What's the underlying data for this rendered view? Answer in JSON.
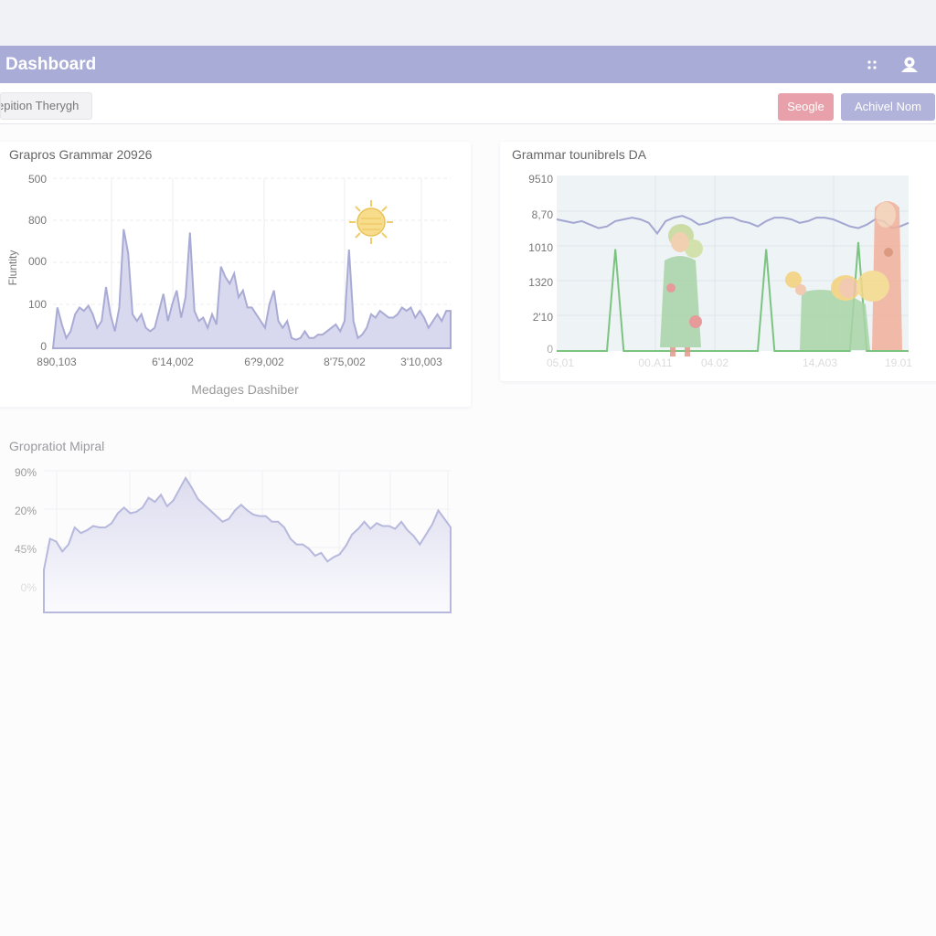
{
  "app": {
    "title": "Dashboard"
  },
  "icons": {
    "menu": "grid-icon",
    "account": "user-icon"
  },
  "colors": {
    "header": "#a9acd6",
    "accent_red": "#e8a1aa",
    "accent_purple": "#b1b3da",
    "chart_fill": "#d6d7ec",
    "chart_line": "#a9abd4",
    "chart_green": "#7bc47f"
  },
  "toolbar": {
    "filter_label": "epition Therygh",
    "google_label": "Seogle",
    "archive_label": "Achivel Nom"
  },
  "cards": [
    {
      "title": "Grapros Grammar 20926",
      "ylabel": "Fluntity",
      "xlabel": "Medages Dashiber",
      "y_ticks": [
        "500",
        "800",
        "000",
        "100",
        "0"
      ],
      "x_ticks": [
        "890,103",
        "6'14,002",
        "6?9,002",
        "8'75,002",
        "3'10,003"
      ],
      "badge": "sun-icon"
    },
    {
      "title": "Grammar tounibrels DA",
      "y_ticks": [
        "9510",
        "8,70",
        "1010",
        "1320",
        "2'10",
        "0"
      ],
      "x_ticks": [
        "05,01",
        "00.A11",
        "04.02",
        "14,A03",
        "19.01"
      ],
      "illustration": "people-illustration"
    },
    {
      "title": "Gropratiot Mipral",
      "y_ticks": [
        "90%",
        "20%",
        "45%",
        "0%"
      ]
    }
  ],
  "chart_data": [
    {
      "type": "area",
      "title": "Grapros Grammar 20926",
      "ylabel": "Fluntity",
      "xlabel": "Medages Dashiber",
      "ylim": [
        0,
        500
      ],
      "grid": true,
      "values": [
        0,
        120,
        70,
        30,
        50,
        100,
        120,
        110,
        125,
        100,
        60,
        80,
        180,
        100,
        50,
        120,
        350,
        280,
        100,
        80,
        100,
        60,
        50,
        60,
        110,
        160,
        80,
        130,
        170,
        90,
        150,
        340,
        110,
        80,
        90,
        60,
        100,
        70,
        240,
        210,
        190,
        220,
        150,
        170,
        120,
        120,
        100,
        80,
        60,
        130,
        170,
        80,
        60,
        80,
        30,
        25,
        30,
        50,
        30,
        30,
        40,
        40,
        50,
        60,
        70,
        50,
        80,
        290,
        80,
        30,
        40,
        60,
        100,
        90,
        110,
        100,
        90,
        90,
        100,
        120,
        110,
        120,
        90,
        110,
        90,
        60,
        80,
        100,
        80,
        110,
        110
      ]
    },
    {
      "type": "line",
      "title": "Grammar tounibrels DA",
      "grid": true,
      "series": [
        {
          "values": [
            75,
            74,
            73,
            74,
            72,
            70,
            71,
            74,
            75,
            76,
            75,
            73,
            67,
            74,
            76,
            77,
            75,
            72,
            73,
            75,
            76,
            76,
            74,
            73,
            71,
            74,
            76,
            76,
            75,
            73,
            74,
            76,
            76,
            75,
            73,
            71,
            70,
            72,
            75,
            74,
            70,
            71,
            73
          ]
        },
        {
          "values": [
            0,
            0,
            0,
            0,
            0,
            0,
            0,
            58,
            0,
            0,
            0,
            0,
            0,
            0,
            0,
            0,
            0,
            0,
            0,
            0,
            0,
            0,
            0,
            0,
            0,
            58,
            0,
            0,
            0,
            0,
            0,
            0,
            0,
            0,
            0,
            0,
            62,
            0,
            0,
            0,
            0,
            0,
            0
          ]
        }
      ]
    },
    {
      "type": "area",
      "title": "Gropratiot Mipral",
      "grid": true,
      "values": [
        30,
        52,
        50,
        43,
        48,
        60,
        56,
        58,
        61,
        60,
        60,
        63,
        70,
        74,
        70,
        71,
        74,
        81,
        78,
        83,
        75,
        79,
        87,
        95,
        88,
        80,
        76,
        72,
        68,
        64,
        66,
        72,
        76,
        72,
        69,
        68,
        68,
        64,
        64,
        60,
        52,
        48,
        48,
        45,
        40,
        42,
        36,
        39,
        41,
        47,
        55,
        59,
        64,
        59,
        63,
        61,
        61,
        59,
        64,
        58,
        54,
        48,
        55,
        62,
        72,
        66,
        60
      ]
    }
  ]
}
